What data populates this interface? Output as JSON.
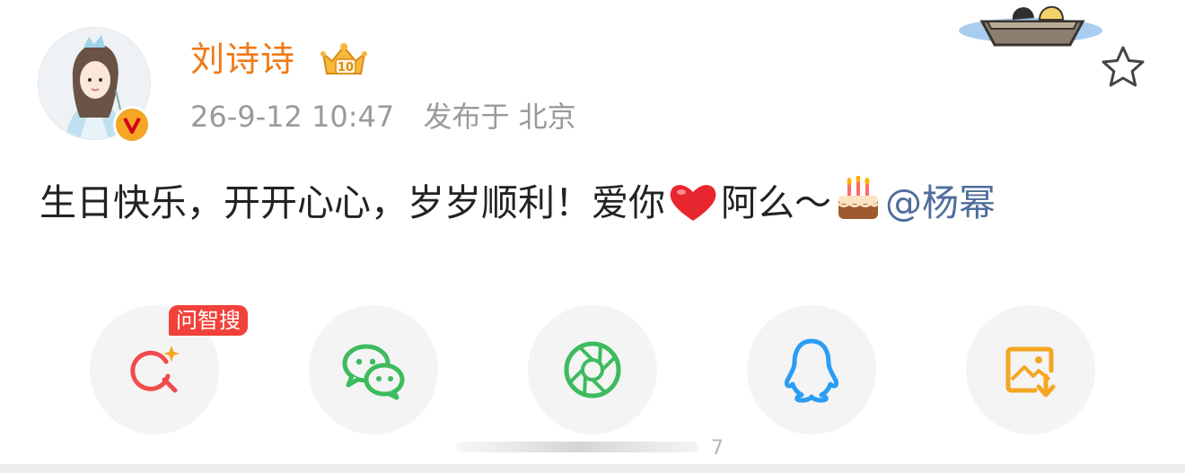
{
  "post": {
    "author": {
      "name": "刘诗诗",
      "avatar": "avatar-illustration",
      "verified_badge": "v-badge",
      "level_badge": "crown-badge"
    },
    "meta": {
      "timestamp": "26-9-12 10:47",
      "location": "发布于 北京"
    },
    "content": {
      "text_part1": "生日快乐，开开心心，岁岁顺利！爱你",
      "text_part2": "阿么～",
      "mention": "@杨幂",
      "emojis": [
        "heart-emoji",
        "cake-emoji"
      ]
    }
  },
  "favorite_icon": "star-outline-icon",
  "share": {
    "tag_label": "问智搜",
    "buttons": [
      {
        "icon": "ai-search-icon",
        "color": "#f24b4b"
      },
      {
        "icon": "wechat-icon",
        "color": "#3dbb5e"
      },
      {
        "icon": "moments-icon",
        "color": "#3dbb5e"
      },
      {
        "icon": "qq-icon",
        "color": "#2a9df4"
      },
      {
        "icon": "save-image-icon",
        "color": "#f5a623"
      }
    ]
  },
  "page_indicator": "7",
  "colors": {
    "name": "#f07a16",
    "meta": "#9a9a9a",
    "mention": "#4f6d9c",
    "tag_bg": "#f2403a"
  }
}
